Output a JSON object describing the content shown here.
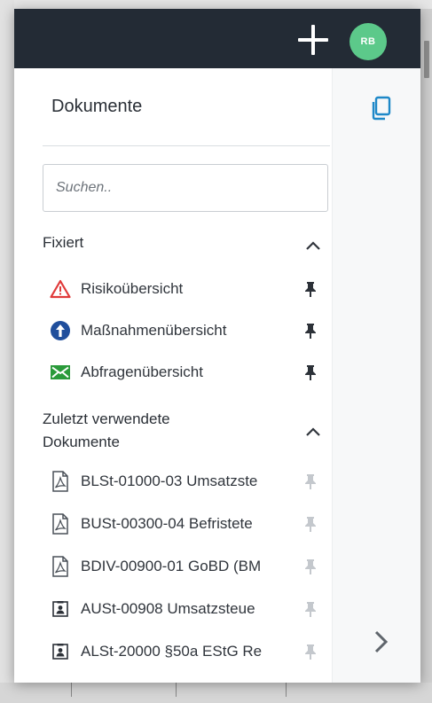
{
  "header": {
    "avatar_initials": "RB"
  },
  "panel": {
    "title": "Dokumente",
    "search": {
      "placeholder": "Suchen..",
      "value": ""
    }
  },
  "pinned": {
    "heading": "Fixiert",
    "items": [
      {
        "label": "Risikoübersicht",
        "icon": "warning-triangle-icon",
        "icon_color": "#e03a3a"
      },
      {
        "label": "Maßnahmenübersicht",
        "icon": "arrow-up-circle-icon",
        "icon_color": "#1f4e9c"
      },
      {
        "label": "Abfragenübersicht",
        "icon": "envelope-icon",
        "icon_color": "#2a9a3a"
      }
    ]
  },
  "recent": {
    "heading_line1": "Zuletzt verwendete",
    "heading_line2": "Dokumente",
    "items": [
      {
        "label": "BLSt-01000-03 Umsatzste",
        "icon": "pdf-file-icon"
      },
      {
        "label": "BUSt-00300-04 Befristete",
        "icon": "pdf-file-icon"
      },
      {
        "label": "BDIV-00900-01 GoBD (BM",
        "icon": "pdf-file-icon"
      },
      {
        "label": "AUSt-00908 Umsatzsteue",
        "icon": "contact-card-icon"
      },
      {
        "label": "ALSt-20000 §50a EStG Re",
        "icon": "contact-card-icon"
      }
    ]
  },
  "colors": {
    "topbar": "#232b35",
    "avatar": "#5cc98a",
    "accent": "#1e88c8"
  }
}
